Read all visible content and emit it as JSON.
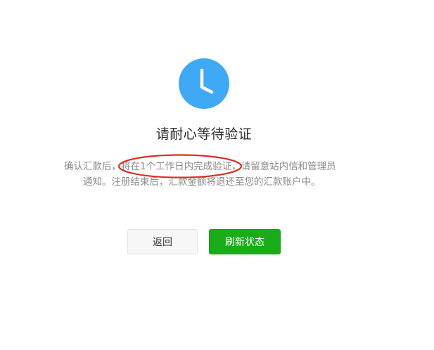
{
  "status": {
    "title": "请耐心等待验证",
    "icon": "clock-icon",
    "icon_color": "#3fa9f5"
  },
  "description": {
    "line1_prefix": "确认汇款后，",
    "line1_highlight": "将在1个工作日内完成验证",
    "line1_suffix": "，请留意站内信和管理员",
    "line2": "通知。注册结束后，汇款金额将退还至您的汇款账户中。",
    "annotation_color": "#d93025"
  },
  "actions": {
    "back_label": "返回",
    "refresh_label": "刷新状态",
    "primary_color": "#1aad19"
  }
}
